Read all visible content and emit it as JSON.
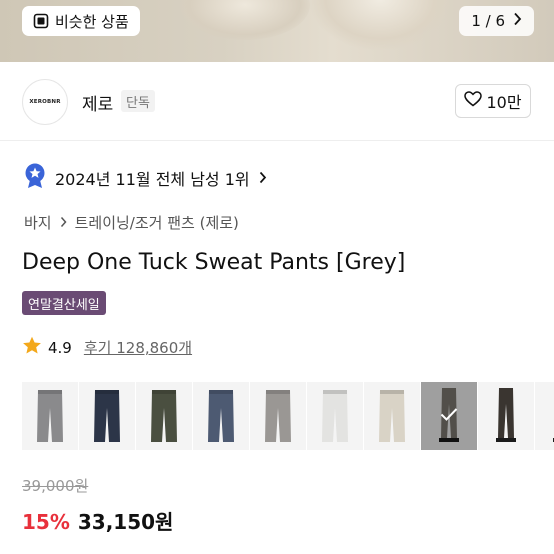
{
  "hero": {
    "similar_button_label": "비슷한 상품",
    "pager_text": "1 / 6",
    "pager_icon": "chevron-right-icon"
  },
  "brand": {
    "logo_text": "XEROBNR",
    "name": "제로",
    "tag": "단독",
    "like_count": "10만"
  },
  "ranking": {
    "text": "2024년 11월 전체 남성 1위",
    "icon": "rank-medal-icon"
  },
  "breadcrumb": {
    "category": "바지",
    "subcategory": "트레이닝/조거 팬츠 (제로)"
  },
  "product": {
    "title": "Deep One Tuck Sweat Pants [Grey]",
    "sale_badge": "연말결산세일",
    "rating": "4.9",
    "reviews": "후기 128,860개"
  },
  "thumbnails": [
    {
      "color": "#8a8a8c",
      "selected": false
    },
    {
      "color": "#2c3548",
      "selected": false
    },
    {
      "color": "#4a4f40",
      "selected": false
    },
    {
      "color": "#4d5a72",
      "selected": false
    },
    {
      "color": "#9a9794",
      "selected": false
    },
    {
      "color": "#e3e3e1",
      "selected": false
    },
    {
      "color": "#d9d3c6",
      "selected": false
    },
    {
      "color": "#7e7a72",
      "selected": true
    },
    {
      "color": "#3a3530",
      "selected": false
    },
    {
      "color": "#2a2826",
      "selected": false
    }
  ],
  "price": {
    "original": "39,000원",
    "discount": "15%",
    "final": "33,150원"
  },
  "colors": {
    "sale_badge_bg": "#6a4b74",
    "discount": "#e8303b",
    "rank_badge": "#3a64d8"
  }
}
